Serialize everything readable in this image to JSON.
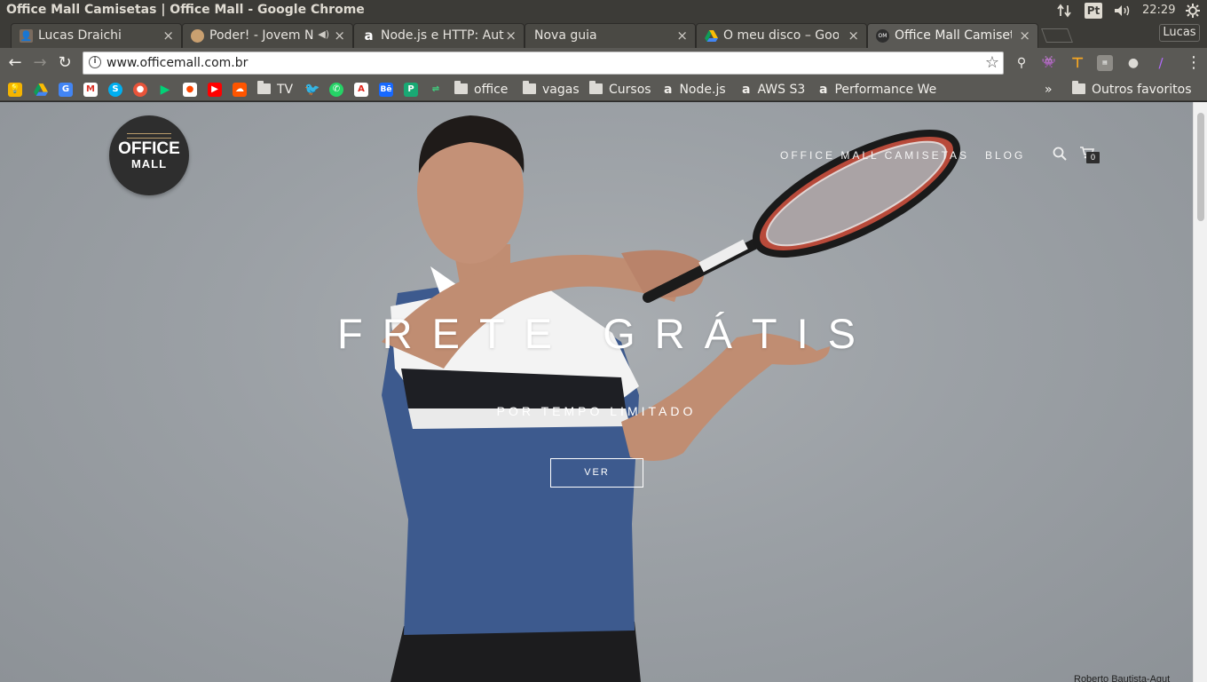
{
  "os": {
    "window_title": "Office Mall Camisetas | Office Mall - Google Chrome",
    "keyboard_layout": "Pt",
    "clock": "22:29"
  },
  "browser": {
    "tabs": [
      {
        "label": "Lucas Draichi",
        "icon": "profile-photo-icon",
        "active": false
      },
      {
        "label": "Poder! - Jovem N",
        "icon": "avatar-face-icon",
        "active": false,
        "audio": true
      },
      {
        "label": "Node.js e HTTP: Aut",
        "icon": "alura-a-icon",
        "active": false
      },
      {
        "label": "Nova guia",
        "icon": "",
        "active": false
      },
      {
        "label": "O meu disco – Goog",
        "icon": "google-drive-icon",
        "active": false
      },
      {
        "label": "Office Mall Camiset",
        "icon": "officemall-logo-icon",
        "active": true
      }
    ],
    "profile_name": "Lucas",
    "url": "www.officemall.com.br",
    "bookmarks": {
      "folders": [
        "TV",
        "office",
        "vagas",
        "Cursos"
      ],
      "links": [
        "Node.js",
        "AWS S3",
        "Performance We"
      ],
      "overflow": "»",
      "other_folder": "Outros favoritos"
    }
  },
  "site": {
    "logo": {
      "line1": "OFFICE",
      "line2": "MALL"
    },
    "nav": {
      "items": [
        "OFFICE MALL CAMISETAS",
        "BLOG"
      ],
      "cart_count": "0"
    },
    "hero": {
      "title": "FRETE GRÁTIS",
      "subtitle": "POR TEMPO LIMITADO",
      "button": "VER",
      "photo_credit": "Roberto Bautista-Agut"
    }
  },
  "colors": {
    "page_bg": "#9ba0a5",
    "shirt_blue": "#3d5a8e",
    "chrome_dark": "#3c3b37",
    "chrome_toolbar": "#5a5955"
  }
}
